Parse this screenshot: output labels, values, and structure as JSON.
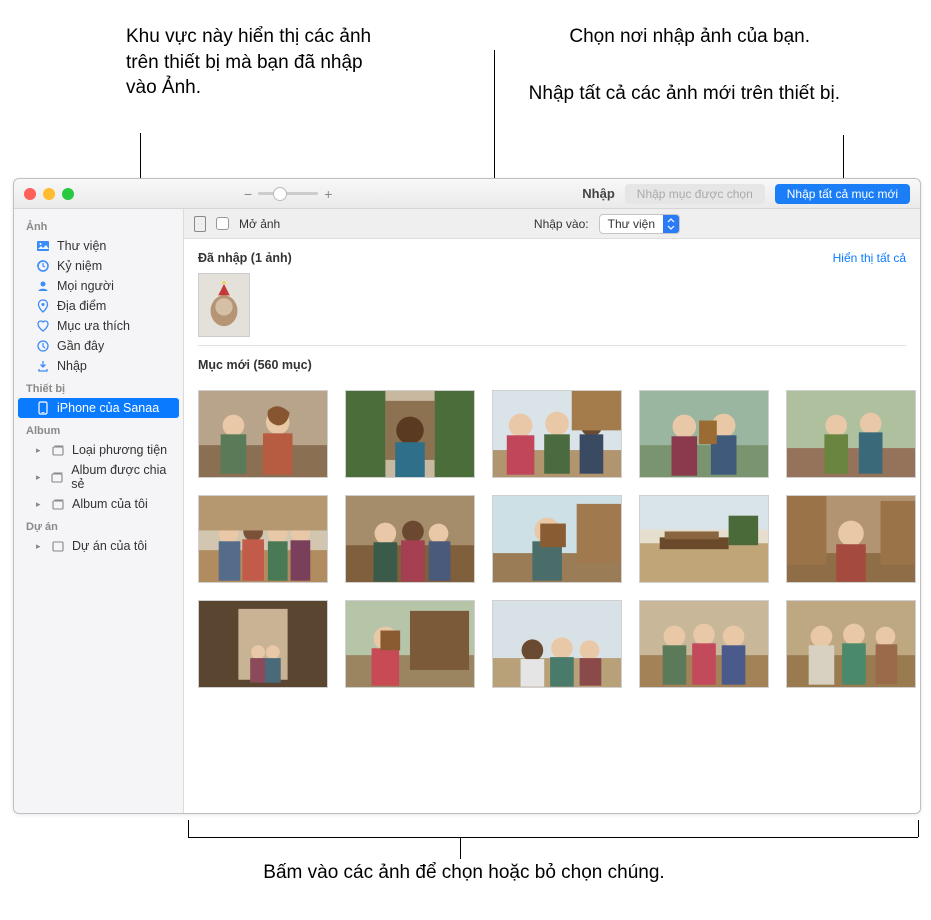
{
  "callouts": {
    "top_left": "Khu vực này hiển thị các ảnh trên thiết bị mà bạn đã nhập vào Ảnh.",
    "top_right_1": "Chọn nơi nhập ảnh của bạn.",
    "top_right_2": "Nhập tất cả các ảnh mới trên thiết bị.",
    "bottom": "Bấm vào các ảnh để chọn hoặc bỏ chọn chúng."
  },
  "toolbar": {
    "title": "Nhập",
    "import_selected": "Nhập mục được chọn",
    "import_all_new": "Nhập tất cả mục mới"
  },
  "optbar": {
    "open_photo": "Mở ảnh",
    "import_to_label": "Nhập vào:",
    "import_to_value": "Thư viện"
  },
  "sidebar": {
    "sections": {
      "photos": "Ảnh",
      "devices": "Thiết bị",
      "albums": "Album",
      "projects": "Dự án"
    },
    "items": {
      "library": "Thư viện",
      "memories": "Kỷ niệm",
      "people": "Mọi người",
      "places": "Địa điểm",
      "favorites": "Mục ưa thích",
      "recent": "Gần đây",
      "import": "Nhập",
      "device": "iPhone của Sanaa",
      "media_types": "Loại phương tiện",
      "shared_albums": "Album được chia sẻ",
      "my_albums": "Album của tôi",
      "my_projects": "Dự án của tôi"
    }
  },
  "content": {
    "imported_header": "Đã nhập (1 ảnh)",
    "show_all": "Hiển thị tất cả",
    "new_items_header": "Mục mới (560 mục)"
  }
}
